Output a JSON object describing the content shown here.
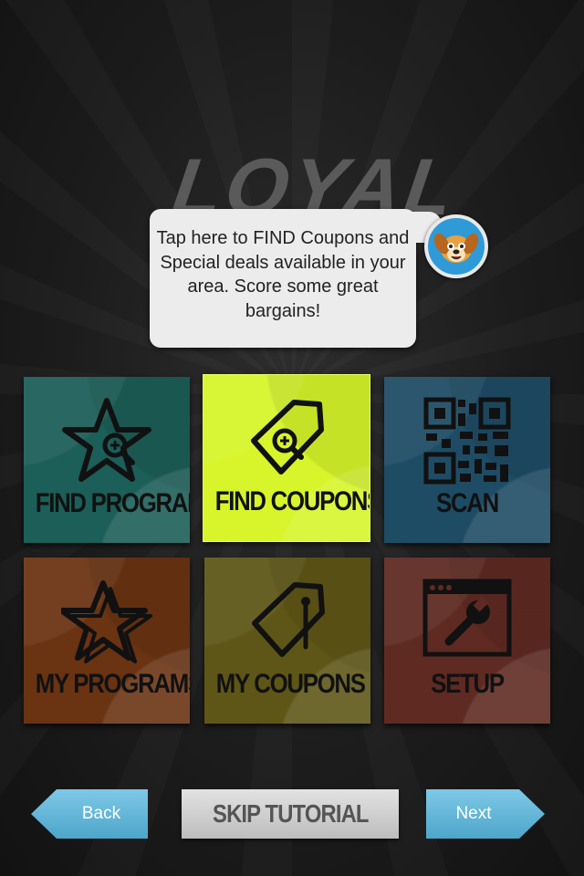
{
  "logo": {
    "text": "LOYAL"
  },
  "tooltip": {
    "text": "Tap here to FIND Coupons and Special deals available in your area. Score some great bargains!",
    "mascot_icon": "dog-mascot-icon"
  },
  "tiles": [
    {
      "label": "FIND PROGRAMS",
      "icon": "star-search-icon",
      "color": "#1c5e58"
    },
    {
      "label": "FIND COUPONS",
      "icon": "tag-search-icon",
      "color": "#d7f52a",
      "highlighted": true
    },
    {
      "label": "SCAN",
      "icon": "qr-code-icon",
      "color": "#1e4c65"
    },
    {
      "label": "MY PROGRAMS",
      "icon": "star-icon",
      "color": "#6a3312"
    },
    {
      "label": "MY COUPONS",
      "icon": "tag-icon",
      "color": "#5e5616"
    },
    {
      "label": "SETUP",
      "icon": "wrench-window-icon",
      "color": "#5e2a22"
    }
  ],
  "nav": {
    "back": "Back",
    "skip": "SKIP TUTORIAL",
    "next": "Next"
  }
}
